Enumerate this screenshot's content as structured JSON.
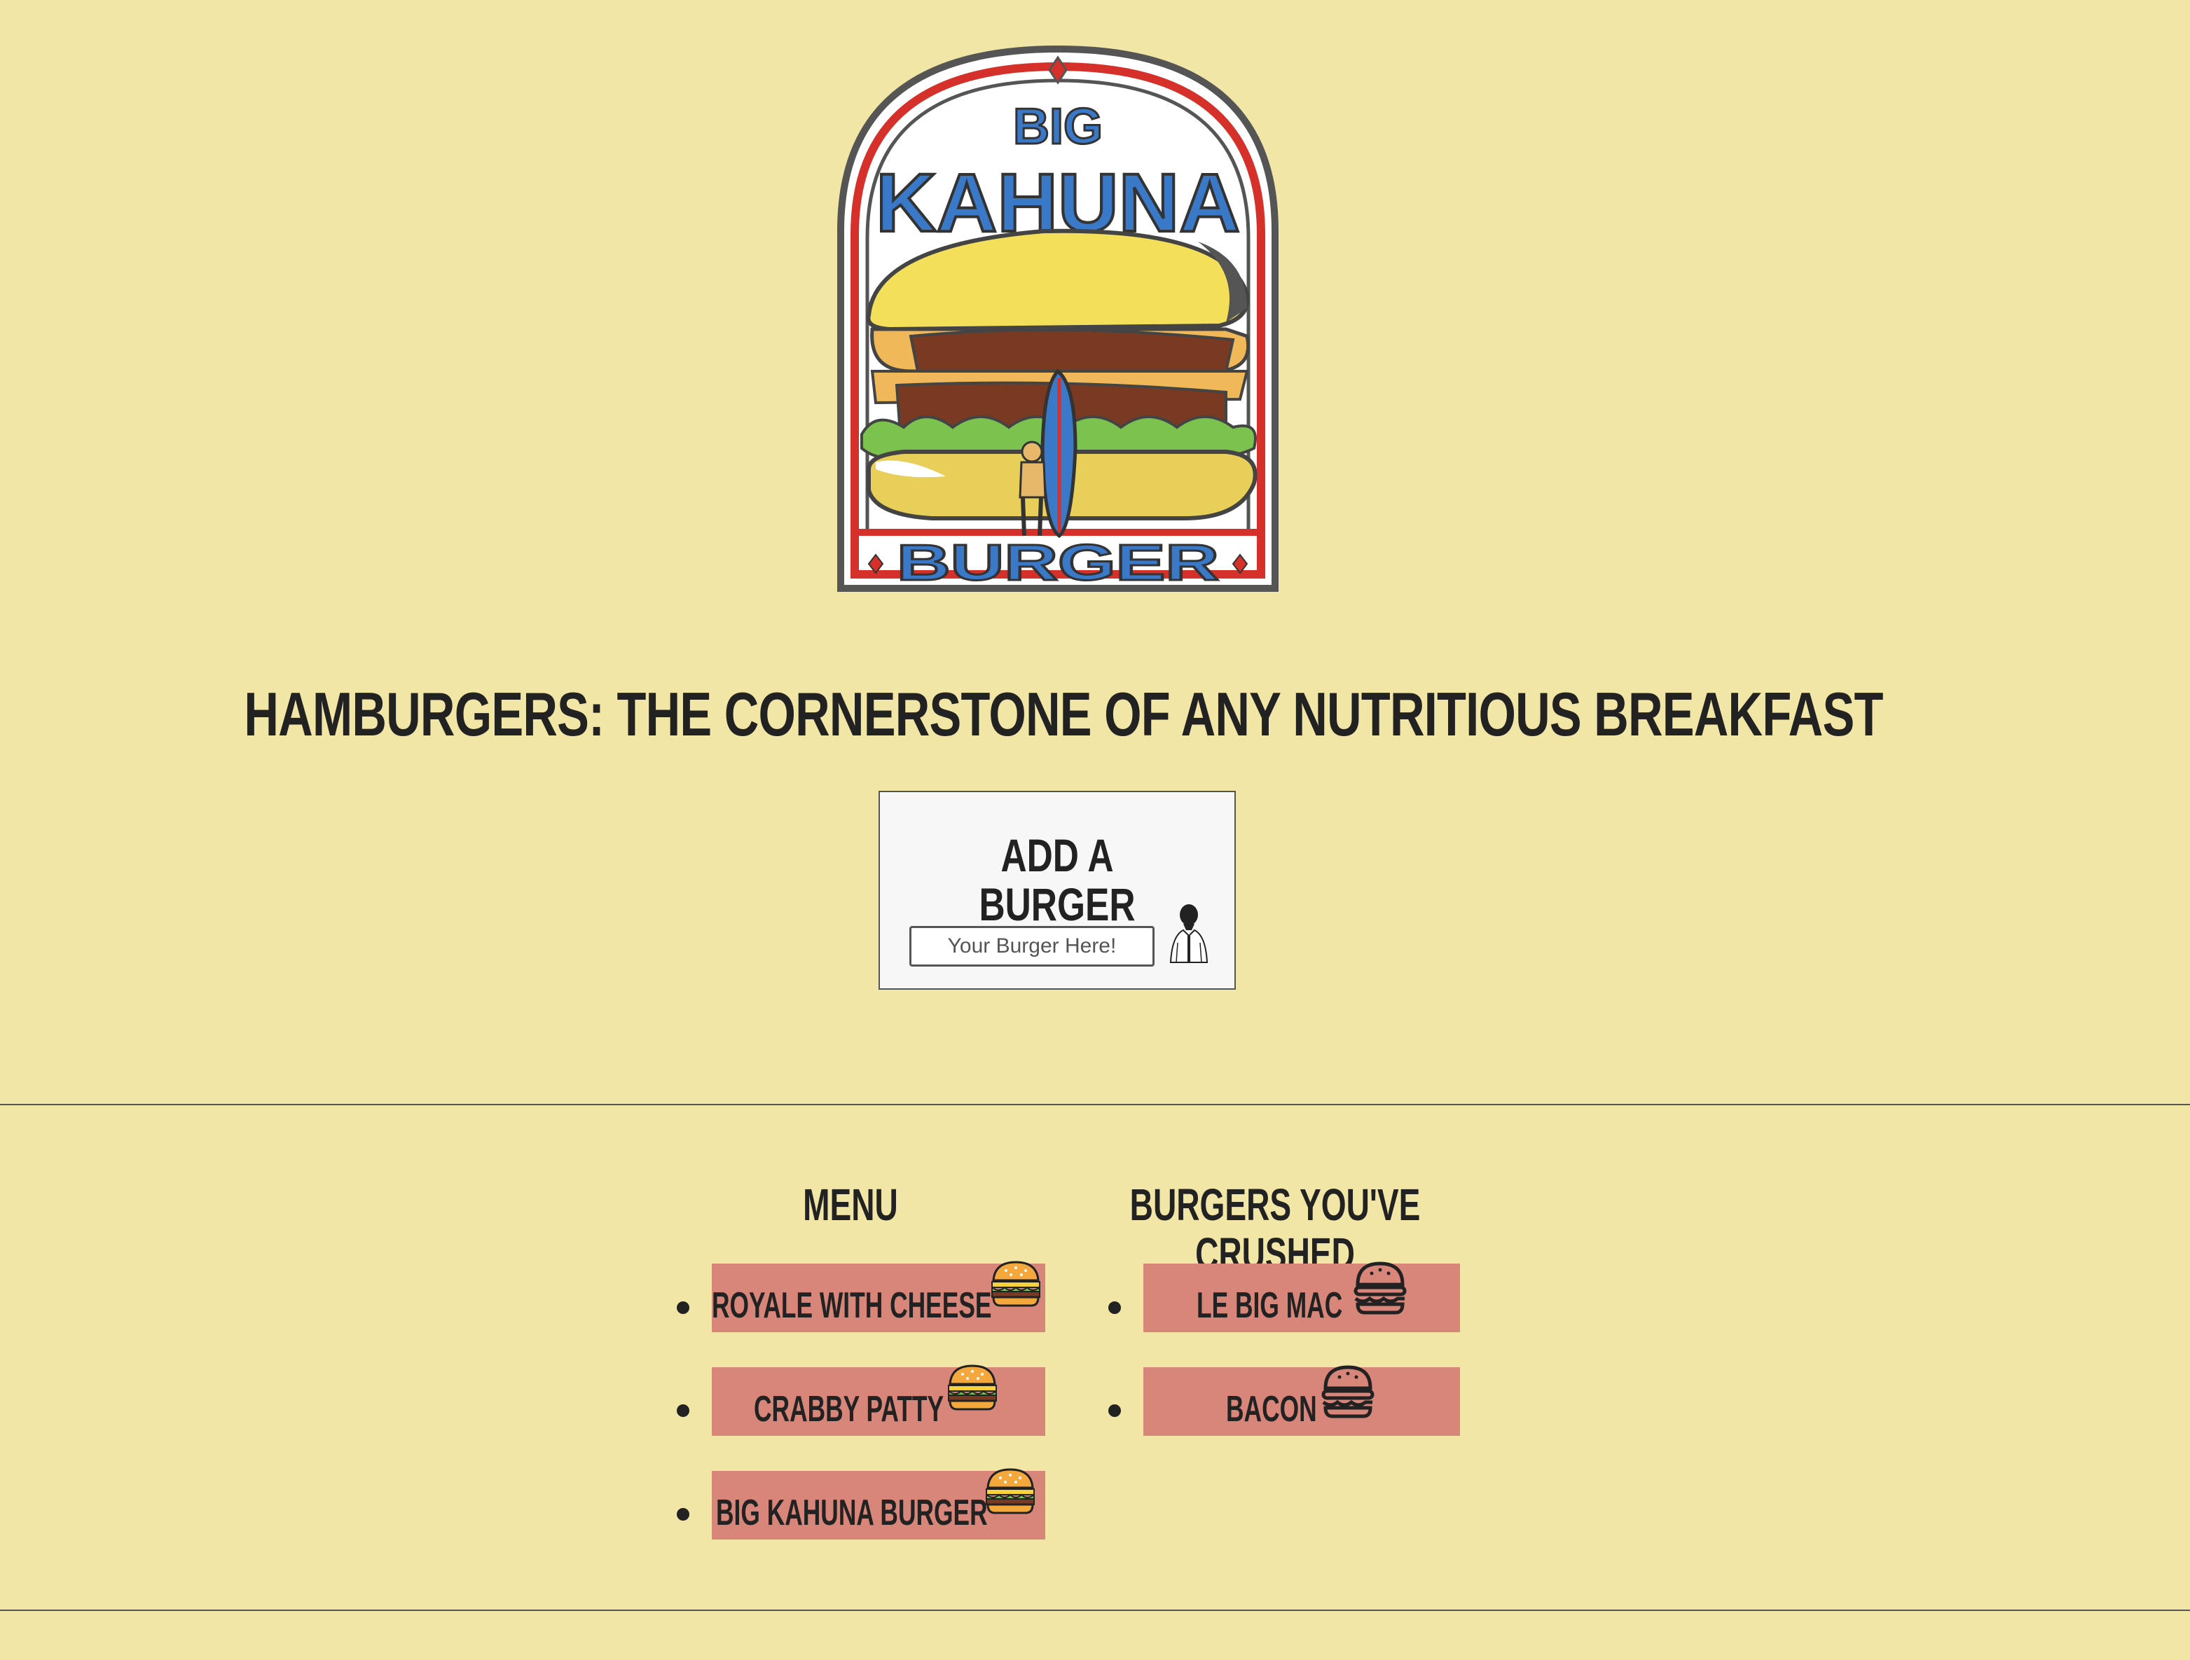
{
  "logo": {
    "top_word": "BIG",
    "main_word": "KAHUNA",
    "bottom_word": "BURGER"
  },
  "tagline": "HAMBURGERS: THE CORNERSTONE OF ANY NUTRITIOUS BREAKFAST",
  "add_form": {
    "title": "ADD A BURGER",
    "input_placeholder": "Your Burger Here!",
    "submit_icon": "jules-figure-icon"
  },
  "menu": {
    "title": "MENU",
    "items": [
      {
        "name": "ROYALE WITH CHEESE",
        "icon": "color-burger-icon"
      },
      {
        "name": "CRABBY PATTY",
        "icon": "color-burger-icon"
      },
      {
        "name": "BIG KAHUNA BURGER",
        "icon": "color-burger-icon"
      }
    ]
  },
  "crushed": {
    "title": "BURGERS YOU'VE CRUSHED",
    "items": [
      {
        "name": "LE BIG MAC",
        "icon": "outline-burger-icon"
      },
      {
        "name": "BACON",
        "icon": "outline-burger-icon"
      }
    ]
  },
  "colors": {
    "page_background": "#f2e6a7",
    "item_background": "#d8857a",
    "card_background": "#f7f7f7",
    "text": "#222222",
    "logo_blue": "#3a78c8",
    "logo_red": "#d6302b"
  }
}
